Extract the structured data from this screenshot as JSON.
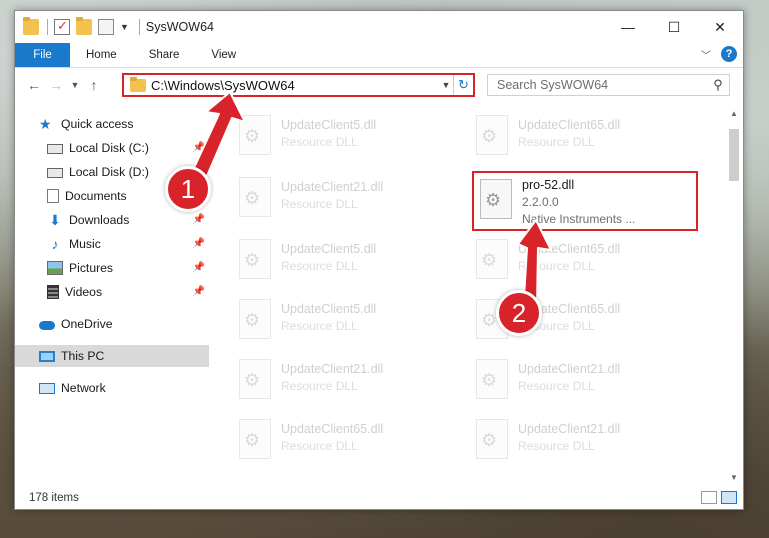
{
  "window": {
    "title": "SysWOW64",
    "controls": {
      "minimize": "—",
      "maximize": "☐",
      "close": "✕"
    }
  },
  "ribbon": {
    "file_tab": "File",
    "tabs": [
      "Home",
      "Share",
      "View"
    ]
  },
  "address_bar": {
    "path": "C:\\Windows\\SysWOW64"
  },
  "search": {
    "placeholder": "Search SysWOW64"
  },
  "sidebar": {
    "items": [
      {
        "label": "Quick access",
        "icon": "star-icon"
      },
      {
        "label": "Local Disk (C:)",
        "icon": "disk-icon",
        "pinned": true
      },
      {
        "label": "Local Disk (D:)",
        "icon": "disk-icon"
      },
      {
        "label": "Documents",
        "icon": "documents-icon",
        "pinned": true
      },
      {
        "label": "Downloads",
        "icon": "downloads-icon",
        "pinned": true
      },
      {
        "label": "Music",
        "icon": "music-icon",
        "pinned": true
      },
      {
        "label": "Pictures",
        "icon": "pictures-icon",
        "pinned": true
      },
      {
        "label": "Videos",
        "icon": "videos-icon",
        "pinned": true
      },
      {
        "label": "OneDrive",
        "icon": "onedrive-icon"
      },
      {
        "label": "This PC",
        "icon": "this-pc-icon",
        "selected": true
      },
      {
        "label": "Network",
        "icon": "network-icon"
      }
    ]
  },
  "files": [
    {
      "name": "UpdateClient5.dll",
      "sub": "Resource DLL"
    },
    {
      "name": "UpdateClient65.dll",
      "sub": "Resource DLL"
    },
    {
      "name": "UpdateClient21.dll",
      "sub": "Resource DLL"
    },
    {
      "name": "pro-52.dll",
      "sub": "2.2.0.0",
      "sub2": "Native Instruments ..."
    },
    {
      "name": "UpdateClient5.dll",
      "sub": "Resource DLL"
    },
    {
      "name": "UpdateClient65.dll",
      "sub": "Resource DLL"
    },
    {
      "name": "UpdateClient5.dll",
      "sub": "Resource DLL"
    },
    {
      "name": "UpdateClient65.dll",
      "sub": "Resource DLL"
    },
    {
      "name": "UpdateClient21.dll",
      "sub": "Resource DLL"
    },
    {
      "name": "UpdateClient21.dll",
      "sub": "Resource DLL"
    },
    {
      "name": "UpdateClient65.dll",
      "sub": "Resource DLL"
    },
    {
      "name": "UpdateClient21.dll",
      "sub": "Resource DLL"
    }
  ],
  "status": {
    "item_count": "178 items"
  },
  "annotations": {
    "step1": "1",
    "step2": "2",
    "color": "#d9232a"
  }
}
